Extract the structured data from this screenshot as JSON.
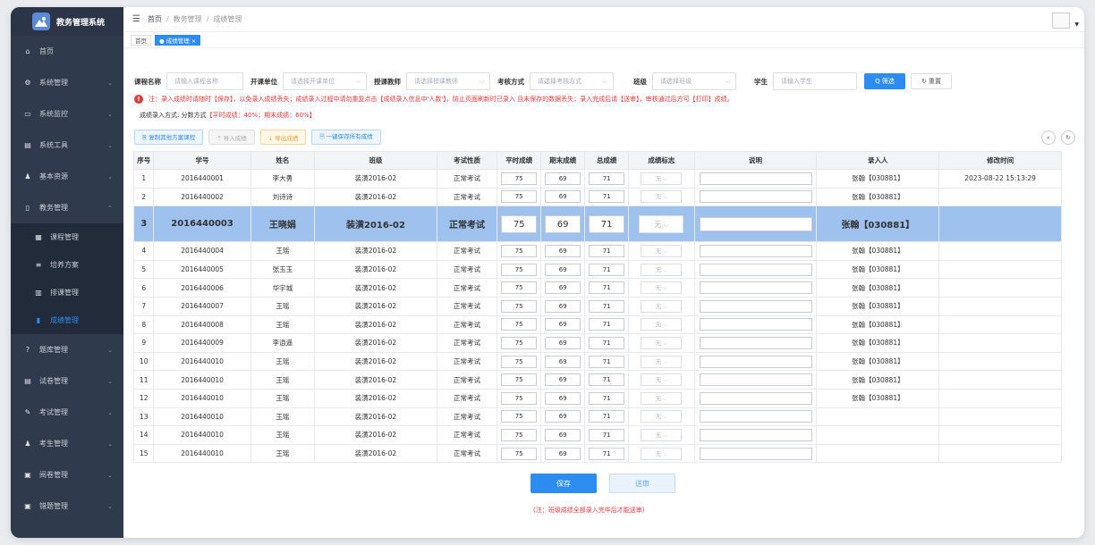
{
  "app": {
    "title": "教务管理系统"
  },
  "sidebar": {
    "items": [
      {
        "icon": "home-icon",
        "label": "首页"
      },
      {
        "icon": "gear-icon",
        "label": "系统管理"
      },
      {
        "icon": "monitor-icon",
        "label": "系统监控"
      },
      {
        "icon": "toolbox-icon",
        "label": "系统工具"
      },
      {
        "icon": "users-icon",
        "label": "基本资源"
      },
      {
        "icon": "book-icon",
        "label": "教务管理"
      }
    ],
    "sub": [
      {
        "icon": "grid-icon",
        "label": "课程管理"
      },
      {
        "icon": "list-icon",
        "label": "培养方案"
      },
      {
        "icon": "calendar-icon",
        "label": "排课管理"
      },
      {
        "icon": "bar-chart-icon",
        "label": "成绩管理"
      }
    ],
    "items2": [
      {
        "icon": "question-icon",
        "label": "题库管理"
      },
      {
        "icon": "paper-icon",
        "label": "试卷管理"
      },
      {
        "icon": "exam-icon",
        "label": "考试管理"
      },
      {
        "icon": "student-icon",
        "label": "考生管理"
      },
      {
        "icon": "marking-icon",
        "label": "阅卷管理"
      },
      {
        "icon": "wrong-book-icon",
        "label": "错题管理"
      }
    ]
  },
  "topbar": {
    "crumb1": "首页",
    "crumb2": "教务管理",
    "crumb3": "成绩管理"
  },
  "tabs": {
    "home": "首页",
    "active": "● 成绩管理 ×"
  },
  "filters": {
    "course_label": "课程名称",
    "course_ph": "请输入课程名称",
    "unit_label": "开课单位",
    "unit_ph": "请选择开课单位",
    "teacher_label": "授课教师",
    "teacher_ph": "请选择授课教师",
    "mode_label": "考核方式",
    "mode_ph": "请选择考核方式",
    "class_label": "班级",
    "class_ph": "请选择班级",
    "student_label": "学生",
    "student_ph": "请输入学生",
    "search": "Q 筛选",
    "reset": "↻ 重置"
  },
  "notice": "注：录入成绩时请随时【保存】，以免录入成绩丢失；成绩录入过程中请勿重复点击【成绩录入信息中'人数'】，防止页面刷新时已录入 且未保存的数据丢失；录入完成后请【送审】，审核通过后方可【打印】成绩。",
  "method": {
    "prefix": "成绩录入方式:  分数方式",
    "detail": "【平时成绩：40%；期末成绩：60%】"
  },
  "actions": {
    "copy": "⎘ 复制其他方案课程",
    "import": "⇡ 导入成绩",
    "export": "⇣ 导出成绩",
    "save_all": "🗎 一键保存所有成绩"
  },
  "table": {
    "headers": [
      "序号",
      "学号",
      "姓名",
      "班级",
      "考试性质",
      "平时成绩",
      "期末成绩",
      "总成绩",
      "成绩标志",
      "说明",
      "录入人",
      "修改时间"
    ],
    "rows": [
      {
        "no": "1",
        "id": "2016440001",
        "name": "李大勇",
        "cls": "装潢2016-02",
        "type": "正常考试",
        "usual": "75",
        "final": "69",
        "total": "71",
        "flag": "无",
        "by": "张翰【030881】",
        "time": "2023-08-22 15:13:29"
      },
      {
        "no": "2",
        "id": "2016440002",
        "name": "刘诗诗",
        "cls": "装潢2016-02",
        "type": "正常考试",
        "usual": "75",
        "final": "69",
        "total": "71",
        "flag": "无",
        "by": "张翰【030881】",
        "time": ""
      },
      {
        "no": "3",
        "id": "2016440003",
        "name": "王晓娟",
        "cls": "装潢2016-02",
        "type": "正常考试",
        "usual": "75",
        "final": "69",
        "total": "71",
        "flag": "无",
        "by": "张翰【030881】",
        "time": ""
      },
      {
        "no": "4",
        "id": "2016440004",
        "name": "王瑶",
        "cls": "装潢2016-02",
        "type": "正常考试",
        "usual": "75",
        "final": "69",
        "total": "71",
        "flag": "无",
        "by": "张翰【030881】",
        "time": ""
      },
      {
        "no": "5",
        "id": "2016440005",
        "name": "张玉玉",
        "cls": "装潢2016-02",
        "type": "正常考试",
        "usual": "75",
        "final": "69",
        "total": "71",
        "flag": "无",
        "by": "张翰【030881】",
        "time": ""
      },
      {
        "no": "6",
        "id": "2016440006",
        "name": "华宇城",
        "cls": "装潢2016-02",
        "type": "正常考试",
        "usual": "75",
        "final": "69",
        "total": "71",
        "flag": "无",
        "by": "张翰【030881】",
        "time": ""
      },
      {
        "no": "7",
        "id": "2016440007",
        "name": "王瑶",
        "cls": "装潢2016-02",
        "type": "正常考试",
        "usual": "75",
        "final": "69",
        "total": "71",
        "flag": "无",
        "by": "张翰【030881】",
        "time": ""
      },
      {
        "no": "8",
        "id": "2016440008",
        "name": "王瑶",
        "cls": "装潢2016-02",
        "type": "正常考试",
        "usual": "75",
        "final": "69",
        "total": "71",
        "flag": "无",
        "by": "张翰【030881】",
        "time": ""
      },
      {
        "no": "9",
        "id": "2016440009",
        "name": "李逍遥",
        "cls": "装潢2016-02",
        "type": "正常考试",
        "usual": "75",
        "final": "69",
        "total": "71",
        "flag": "无",
        "by": "张翰【030881】",
        "time": ""
      },
      {
        "no": "10",
        "id": "2016440010",
        "name": "王瑶",
        "cls": "装潢2016-02",
        "type": "正常考试",
        "usual": "75",
        "final": "69",
        "total": "71",
        "flag": "无",
        "by": "张翰【030881】",
        "time": ""
      },
      {
        "no": "11",
        "id": "2016440010",
        "name": "王瑶",
        "cls": "装潢2016-02",
        "type": "正常考试",
        "usual": "75",
        "final": "69",
        "total": "71",
        "flag": "无",
        "by": "张翰【030881】",
        "time": ""
      },
      {
        "no": "12",
        "id": "2016440010",
        "name": "王瑶",
        "cls": "装潢2016-02",
        "type": "正常考试",
        "usual": "75",
        "final": "69",
        "total": "71",
        "flag": "无",
        "by": "张翰【030881】",
        "time": ""
      },
      {
        "no": "13",
        "id": "2016440010",
        "name": "王瑶",
        "cls": "装潢2016-02",
        "type": "正常考试",
        "usual": "75",
        "final": "69",
        "total": "71",
        "flag": "无",
        "by": "",
        "time": ""
      },
      {
        "no": "14",
        "id": "2016440010",
        "name": "王瑶",
        "cls": "装潢2016-02",
        "type": "正常考试",
        "usual": "75",
        "final": "69",
        "total": "71",
        "flag": "无",
        "by": "",
        "time": ""
      },
      {
        "no": "15",
        "id": "2016440010",
        "name": "王瑶",
        "cls": "装潢2016-02",
        "type": "正常考试",
        "usual": "75",
        "final": "69",
        "total": "71",
        "flag": "无",
        "by": "",
        "time": ""
      }
    ]
  },
  "buttons": {
    "save": "保存",
    "submit": "送审"
  },
  "footnote": "(注：班级成绩全部录入完毕后才能送审)"
}
